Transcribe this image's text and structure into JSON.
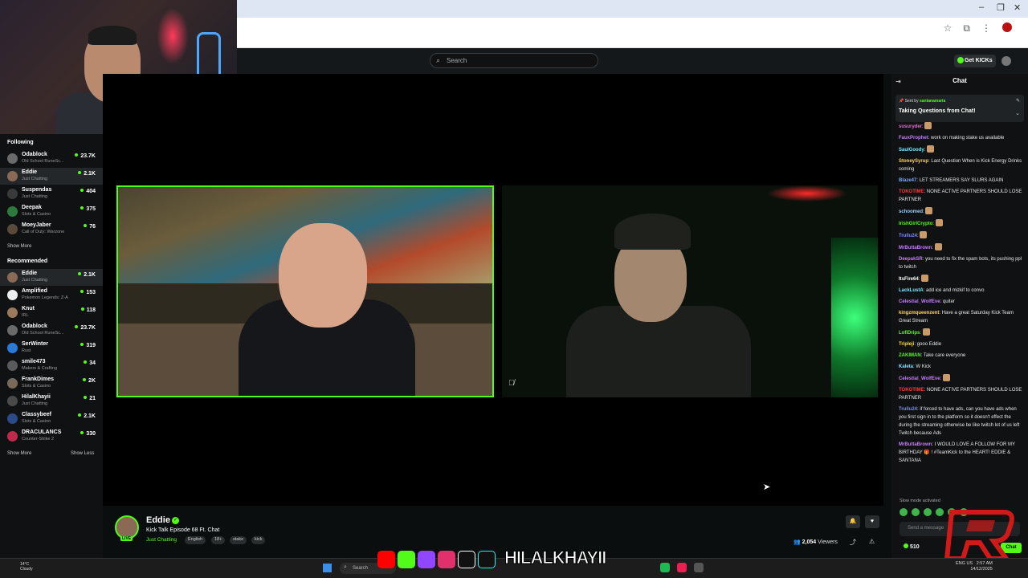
{
  "browser": {
    "window_controls": [
      "–",
      "❐",
      "✕"
    ],
    "icons": [
      "star-icon",
      "extensions-icon",
      "menu-icon"
    ]
  },
  "header": {
    "search_placeholder": "Search",
    "get_kicks_label": "Get KICKs"
  },
  "sidebar": {
    "following_title": "Following",
    "following": [
      {
        "name": "Odablock",
        "category": "Old School RuneSc...",
        "viewers": "23.7K",
        "color": "#6a6a6a"
      },
      {
        "name": "Eddie",
        "category": "Just Chatting",
        "viewers": "2.1K",
        "color": "#8a6a55",
        "active": true
      },
      {
        "name": "Suspendas",
        "category": "Just Chatting",
        "viewers": "404",
        "color": "#3a3a3a"
      },
      {
        "name": "Deepak",
        "category": "Slots & Casino",
        "viewers": "375",
        "color": "#2d7a3d"
      },
      {
        "name": "MoeyJaber",
        "category": "Call of Duty: Warzone",
        "viewers": "76",
        "color": "#5a4a3a"
      }
    ],
    "following_show_more": "Show More",
    "recommended_title": "Recommended",
    "recommended": [
      {
        "name": "Eddie",
        "category": "Just Chatting",
        "viewers": "2.1K",
        "color": "#8a6a55",
        "active": true
      },
      {
        "name": "Amplified",
        "category": "Pokemon Legends: Z-A",
        "viewers": "153",
        "color": "#eeeeee"
      },
      {
        "name": "Knut",
        "category": "IRL",
        "viewers": "118",
        "color": "#9a7a5a"
      },
      {
        "name": "Odablock",
        "category": "Old School RuneSc...",
        "viewers": "23.7K",
        "color": "#6a6a6a"
      },
      {
        "name": "SerWinter",
        "category": "Rust",
        "viewers": "319",
        "color": "#2a7ad8"
      },
      {
        "name": "smile473",
        "category": "Makers & Crafting",
        "viewers": "34",
        "color": "#5a5a5a"
      },
      {
        "name": "FrankDimes",
        "category": "Slots & Casino",
        "viewers": "2K",
        "color": "#7a6a5a"
      },
      {
        "name": "HilalKhayii",
        "category": "Just Chatting",
        "viewers": "21",
        "color": "#4a4a4a"
      },
      {
        "name": "Classybeef",
        "category": "Slots & Casino",
        "viewers": "2.1K",
        "color": "#2a4a8a"
      },
      {
        "name": "DRACULANCS",
        "category": "Counter-Strike 2",
        "viewers": "330",
        "color": "#c02a4a"
      }
    ],
    "recommended_show_more": "Show More",
    "recommended_show_less": "Show Less"
  },
  "stream": {
    "streamer": "Eddie",
    "live_badge": "LIVE",
    "title": "Kick Talk Episode 68 Ft. Chat",
    "category": "Just Chatting",
    "tags": [
      "English",
      "18+",
      "stake",
      "kick"
    ],
    "viewers_count": "2,054",
    "viewers_label": "Viewers"
  },
  "chat": {
    "title": "Chat",
    "pinned_sent_by": "Sent by",
    "pinned_user": "santanamaria",
    "pinned_message": "Taking Questions from Chat!",
    "messages": [
      {
        "user": "susuryder",
        "color": "#e86bd0",
        "text": ""
      },
      {
        "user": "FauxProphet",
        "color": "#c87bff",
        "text": "work on making stake us available"
      },
      {
        "user": "SaulGoody",
        "color": "#7be8ff",
        "text": ""
      },
      {
        "user": "StoneySyrup",
        "color": "#ffd84a",
        "text": "Last Question When is Kick Energy Drinks coming"
      },
      {
        "user": "Blaze47",
        "color": "#7ba8ff",
        "text": "LET STREAMERS SAY SLURS AGAIN"
      },
      {
        "user": "TOKOTIME",
        "color": "#ff3b3b",
        "text": "NONE ACTIVE PARTNERS SHOULD LOSE PARTNER"
      },
      {
        "user": "schoomed",
        "color": "#9ad0ff",
        "text": ""
      },
      {
        "user": "IrishGirlCrypto",
        "color": "#53fc18",
        "text": ""
      },
      {
        "user": "Trullu24",
        "color": "#7b8bff",
        "text": ""
      },
      {
        "user": "MrButtaBrown",
        "color": "#c87bff",
        "text": ""
      },
      {
        "user": "DeepakSR",
        "color": "#c87bff",
        "text": "you need to fix the spam bots, its pushing ppl to twitch"
      },
      {
        "user": "ItsFire64",
        "color": "#ffffff",
        "text": ""
      },
      {
        "user": "LackLustA",
        "color": "#7be8ff",
        "text": "add ice and mizkif to convo"
      },
      {
        "user": "Celestial_WolfEve",
        "color": "#c87bff",
        "text": "quiter"
      },
      {
        "user": "kingzmqueenzent",
        "color": "#ffd84a",
        "text": "Have a great Saturday Kick Team Great Stream"
      },
      {
        "user": "LofiDrips",
        "color": "#53fc18",
        "text": ""
      },
      {
        "user": "Tripleji",
        "color": "#ffd84a",
        "text": "gooo Eddie"
      },
      {
        "user": "ZAKIMAN",
        "color": "#53fc18",
        "text": "Take care everyone"
      },
      {
        "user": "Kaleta",
        "color": "#7be8ff",
        "text": "W Kick"
      },
      {
        "user": "Celestial_WolfEve",
        "color": "#c87bff",
        "text": ""
      },
      {
        "user": "TOKOTIME",
        "color": "#ff3b3b",
        "text": "NONE ACTIVE PARTNERS SHOULD LOSE PARTNER"
      },
      {
        "user": "Trullu24",
        "color": "#7b8bff",
        "text": "if forced to have ads, can you have ads when you first sign in to the platform so it doesn't effect the during the streaming otherwise be like twitch lot of us left Twitch because Ads"
      },
      {
        "user": "MrButtaBrown",
        "color": "#c87bff",
        "text": "I WOULD LOVE A FOLLOW FOR MY BIRTHDAY 🎁 ! #TeamKick to the HEART! EDDIE & SANTANA"
      }
    ],
    "slow_mode": "Slow mode activated",
    "input_placeholder": "Send a message",
    "kicks_balance": "510",
    "chat_button": "Chat"
  },
  "taskbar": {
    "weather_temp": "14°C",
    "weather_desc": "Cloudy",
    "search_label": "Search",
    "overlay_handle": "HILALKHAYII",
    "tray_lang": "ENG US",
    "clock_time": "2:57 AM",
    "clock_date": "14/12/2025"
  },
  "colors": {
    "accent": "#53fc18",
    "background": "#0b0e0f",
    "panel": "#0f1112"
  }
}
